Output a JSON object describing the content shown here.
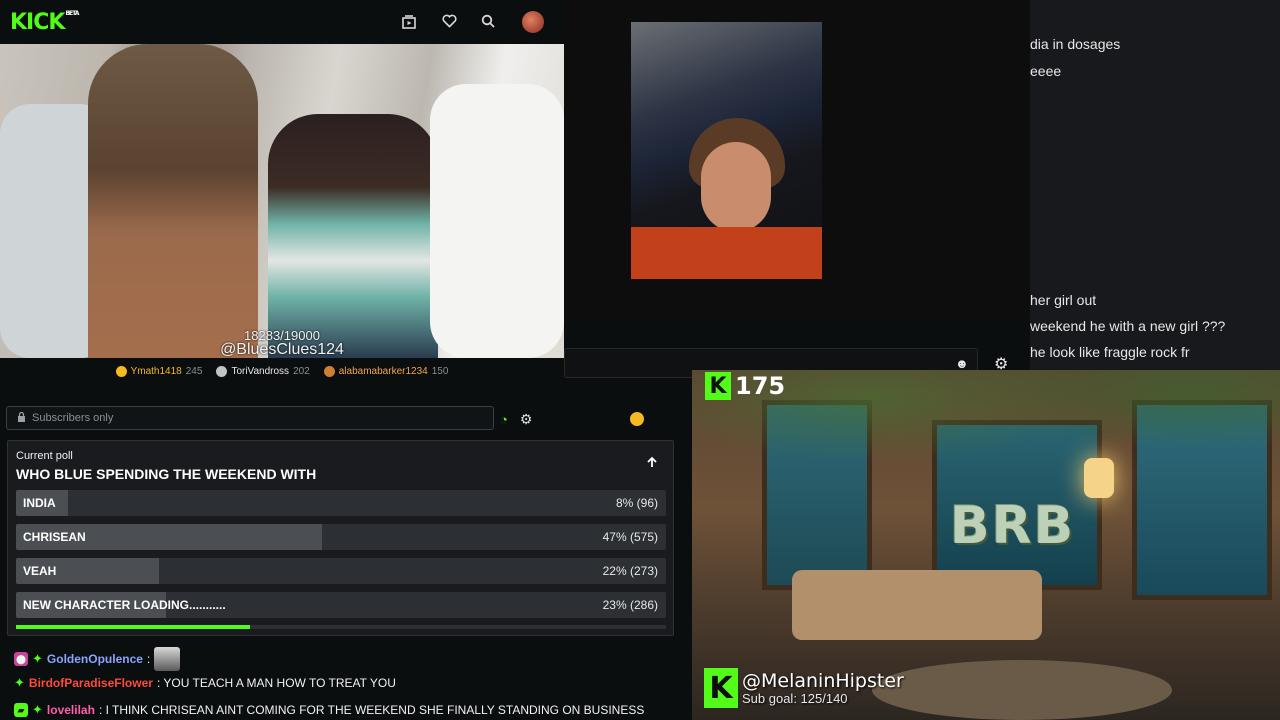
{
  "topbar": {
    "logo": "KICK",
    "logo_tag": "BETA",
    "icons": [
      "clips-icon",
      "heart-icon",
      "search-icon"
    ]
  },
  "video": {
    "counter": "18283/19000",
    "handle": "@BluesClues124"
  },
  "gifters": [
    {
      "name": "Ymath1418",
      "amount": "245",
      "color": "#f5b921"
    },
    {
      "name": "ToriVandross",
      "amount": "202",
      "color": "#c0c4c8"
    },
    {
      "name": "alabamabarker1234",
      "amount": "150",
      "color": "#cd7f32"
    }
  ],
  "chat_input": {
    "mode": "Subscribers only"
  },
  "poll": {
    "label": "Current poll",
    "question": "WHO BLUE SPENDING THE WEEKEND WITH",
    "options": [
      {
        "name": "INDIA",
        "result": "8% (96)",
        "fraction": 0.08
      },
      {
        "name": "CHRISEAN",
        "result": "47% (575)",
        "fraction": 0.47
      },
      {
        "name": "VEAH",
        "result": "22% (273)",
        "fraction": 0.22
      },
      {
        "name": "NEW CHARACTER LOADING...........",
        "result": "23% (286)",
        "fraction": 0.23
      }
    ],
    "time_remaining_fraction": 0.36,
    "accent": "#53fc18"
  },
  "chat": [
    {
      "user": "GoldenOpulence",
      "user_color": "#8aa4ff",
      "text": ""
    },
    {
      "user": "BirdofParadiseFlower",
      "user_color": "#ff4a3a",
      "text": ": YOU TEACH A MAN HOW TO TREAT YOU"
    },
    {
      "user": "lovelilah",
      "user_color": "#ff5fa8",
      "text": ": I THINK CHRISEAN AINT COMING FOR THE WEEKEND SHE FINALLY STANDING ON BUSINESS"
    }
  ],
  "right_chat": [
    "dia in dosages",
    "eeee",
    "her girl out",
    "weekend he with a new girl ???",
    "he look like fraggle rock fr"
  ],
  "brb": {
    "kick_count": "175",
    "text": "BRB",
    "handle": "@MelaninHipster",
    "sub_goal": "Sub goal: 125/140"
  }
}
